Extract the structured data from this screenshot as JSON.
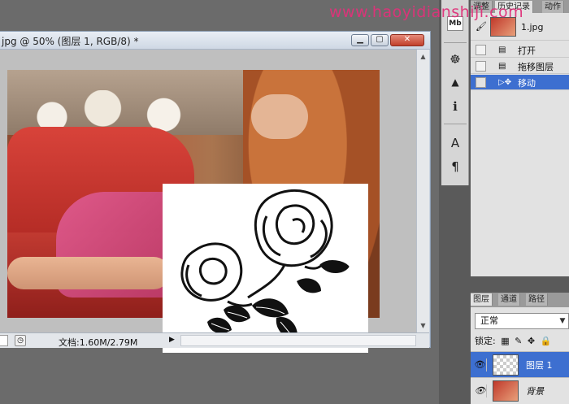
{
  "watermark": "www.haoyidianshiji.com",
  "document": {
    "title": "jpg @ 50% (图层 1, RGB/8) *",
    "window_buttons": {
      "minimize": "▁",
      "maximize": "▢",
      "close": "✕"
    },
    "status_text": "文档:1.60M/2.79M",
    "status_arrow": "▶"
  },
  "tool_strip": {
    "buttons": [
      {
        "name": "mini-bridge-icon",
        "glyph": "Mb"
      },
      {
        "name": "navigator-wheel-icon",
        "glyph": "☸"
      },
      {
        "name": "histogram-icon",
        "glyph": "▲"
      },
      {
        "name": "info-icon",
        "glyph": "ℹ"
      },
      {
        "name": "character-icon",
        "glyph": "A"
      },
      {
        "name": "paragraph-icon",
        "glyph": "¶"
      }
    ]
  },
  "history_panel": {
    "tabs": [
      "调整",
      "历史记录",
      "动作"
    ],
    "snapshot_label": "1.jpg",
    "items": [
      {
        "label": "打开",
        "selected": false
      },
      {
        "label": "拖移图层",
        "selected": false
      },
      {
        "label": "移动",
        "selected": true
      }
    ]
  },
  "layers_panel": {
    "tabs": [
      "图层",
      "通道",
      "路径"
    ],
    "blend_mode": "正常",
    "lock_label": "锁定:",
    "layers": [
      {
        "name": "图层 1",
        "selected": true,
        "thumb": "checker"
      },
      {
        "name": "背景",
        "selected": false,
        "thumb": "photo"
      }
    ]
  }
}
